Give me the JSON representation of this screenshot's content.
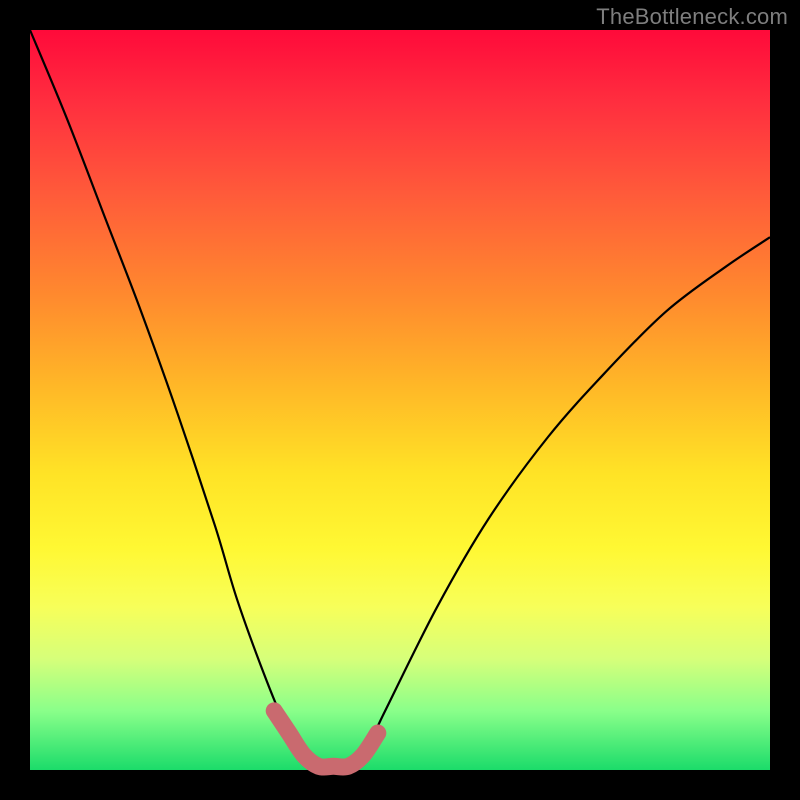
{
  "attribution": "TheBottleneck.com",
  "chart_data": {
    "type": "line",
    "title": "",
    "xlabel": "",
    "ylabel": "",
    "xlim": [
      0,
      100
    ],
    "ylim": [
      0,
      100
    ],
    "series": [
      {
        "name": "curve",
        "x": [
          0,
          5,
          10,
          15,
          20,
          25,
          28,
          32,
          35,
          37,
          39,
          41,
          43,
          45,
          48,
          55,
          62,
          70,
          78,
          86,
          94,
          100
        ],
        "values": [
          100,
          88,
          75,
          62,
          48,
          33,
          23,
          12,
          5,
          2,
          0.5,
          0.5,
          0.5,
          2,
          8,
          22,
          34,
          45,
          54,
          62,
          68,
          72
        ]
      },
      {
        "name": "highlight",
        "x": [
          33,
          35,
          37,
          39,
          41,
          43,
          45,
          47
        ],
        "values": [
          8,
          5,
          2,
          0.5,
          0.5,
          0.5,
          2,
          5
        ]
      }
    ],
    "colors": {
      "curve": "#000000",
      "highlight": "#c96a6f",
      "gradient_top": "#ff0a3a",
      "gradient_bottom": "#1bdc6a"
    }
  }
}
